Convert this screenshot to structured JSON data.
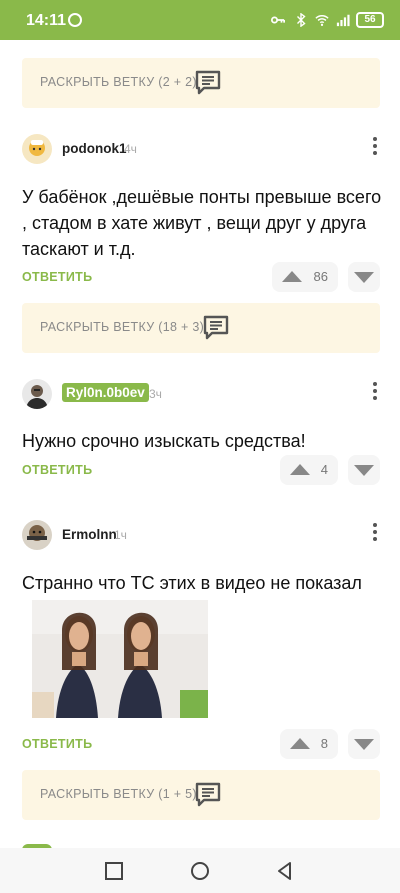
{
  "status_bar": {
    "time": "14:11",
    "battery": "56",
    "icons": [
      "whatsapp-icon",
      "key-icon",
      "bluetooth-icon",
      "wifi-icon",
      "signal-icon",
      "battery-icon"
    ]
  },
  "threads": [
    {
      "label": "РАСКРЫТЬ ВЕТКУ (2 + 2)"
    },
    {
      "label": "РАСКРЫТЬ ВЕТКУ (18 + 3)"
    },
    {
      "label": "РАСКРЫТЬ ВЕТКУ (1 + 5)"
    }
  ],
  "comments": [
    {
      "username": "podonok1",
      "time": "4ч",
      "text": "У бабёнок ,дешёвые понты превыше всего , стадом в хате живут , вещи друг у друга таскают и т.д.",
      "reply_label": "ОТВЕТИТЬ",
      "votes": "86"
    },
    {
      "username": "Ryl0n.0b0ev",
      "time": "3ч",
      "text": "Нужно срочно изыскать средства!",
      "reply_label": "ОТВЕТИТЬ",
      "votes": "4"
    },
    {
      "username": "Ermolnn",
      "time": "1ч",
      "text": "Странно что ТС этих в видео не показал",
      "reply_label": "ОТВЕТИТЬ",
      "votes": "8"
    }
  ],
  "colors": {
    "accent": "#8ab94a",
    "thread_bg": "#fdf6e3",
    "vote_bg": "#f5f5f5"
  }
}
